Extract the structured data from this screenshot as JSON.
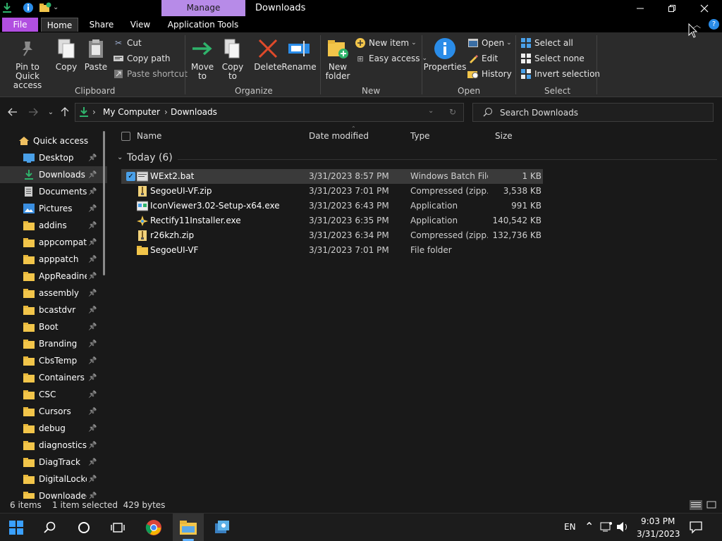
{
  "titlebar": {
    "manage_tab": "Manage",
    "title": "Downloads"
  },
  "ribbon_tabs": [
    "File",
    "Home",
    "Share",
    "View",
    "Application Tools"
  ],
  "ribbon": {
    "clipboard": {
      "label": "Clipboard",
      "pin": "Pin to Quick access",
      "copy": "Copy",
      "paste": "Paste",
      "cut": "Cut",
      "copy_path": "Copy path",
      "paste_shortcut": "Paste shortcut"
    },
    "organize": {
      "label": "Organize",
      "move_to": "Move to",
      "copy_to": "Copy to",
      "delete": "Delete",
      "rename": "Rename"
    },
    "new": {
      "label": "New",
      "new_folder": "New folder",
      "new_item": "New item",
      "easy_access": "Easy access"
    },
    "open": {
      "label": "Open",
      "properties": "Properties",
      "open": "Open",
      "edit": "Edit",
      "history": "History"
    },
    "select": {
      "label": "Select",
      "select_all": "Select all",
      "select_none": "Select none",
      "invert_selection": "Invert selection"
    }
  },
  "address": {
    "crumbs": [
      "My Computer",
      "Downloads"
    ],
    "search_placeholder": "Search Downloads"
  },
  "sidebar": {
    "quick_access": "Quick access",
    "items": [
      "Desktop",
      "Downloads",
      "Documents",
      "Pictures",
      "addins",
      "appcompat",
      "apppatch",
      "AppReadiness",
      "assembly",
      "bcastdvr",
      "Boot",
      "Branding",
      "CbsTemp",
      "Containers",
      "CSC",
      "Cursors",
      "debug",
      "diagnostics",
      "DiagTrack",
      "DigitalLocker",
      "Downloaded"
    ]
  },
  "columns": {
    "name": "Name",
    "date": "Date modified",
    "type": "Type",
    "size": "Size"
  },
  "group": "Today (6)",
  "files": [
    {
      "name": "WExt2.bat",
      "date": "3/31/2023 8:57 PM",
      "type": "Windows Batch File",
      "size": "1 KB",
      "icon": "bat-file-icon"
    },
    {
      "name": "SegoeUI-VF.zip",
      "date": "3/31/2023 7:01 PM",
      "type": "Compressed (zipp...",
      "size": "3,538 KB",
      "icon": "zip-file-icon"
    },
    {
      "name": "IconViewer3.02-Setup-x64.exe",
      "date": "3/31/2023 6:43 PM",
      "type": "Application",
      "size": "991 KB",
      "icon": "exe-file-icon"
    },
    {
      "name": "Rectify11Installer.exe",
      "date": "3/31/2023 6:35 PM",
      "type": "Application",
      "size": "140,542 KB",
      "icon": "installer-icon"
    },
    {
      "name": "r26kzh.zip",
      "date": "3/31/2023 6:34 PM",
      "type": "Compressed (zipp...",
      "size": "132,736 KB",
      "icon": "zip-file-icon"
    },
    {
      "name": "SegoeUI-VF",
      "date": "3/31/2023 7:01 PM",
      "type": "File folder",
      "size": "",
      "icon": "folder-icon"
    }
  ],
  "status": {
    "items": "6 items",
    "selected": "1 item selected  429 bytes"
  },
  "taskbar": {
    "lang": "EN",
    "time": "9:03 PM",
    "date": "3/31/2023"
  },
  "colors": {
    "manage": "#b78be8",
    "file_tab": "#b14fe0",
    "accent": "#4aa0e8",
    "folder": "#f2c54a"
  }
}
